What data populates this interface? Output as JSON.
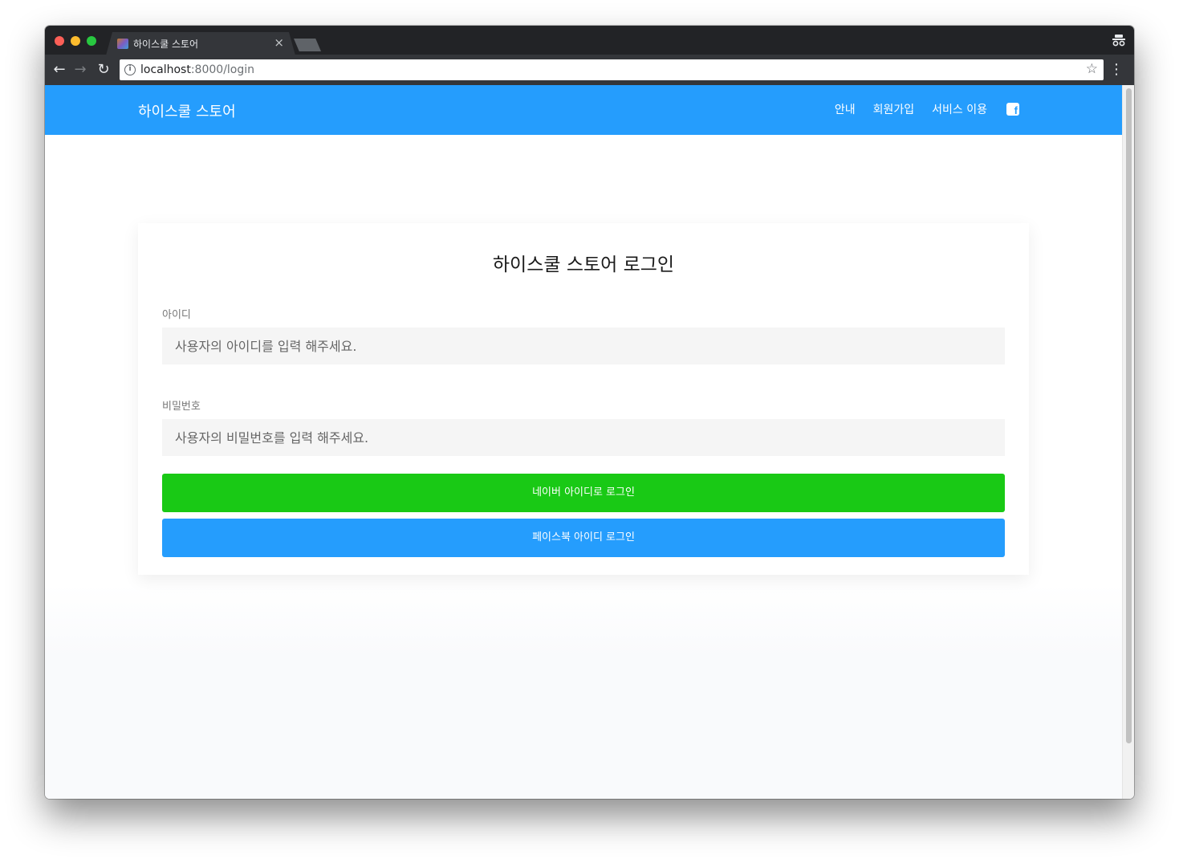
{
  "browser": {
    "tab_title": "하이스쿨 스토어",
    "tab_close": "×",
    "url_host": "localhost",
    "url_path": ":8000/login",
    "back_glyph": "←",
    "forward_glyph": "→",
    "reload_glyph": "↻",
    "star_glyph": "☆",
    "menu_glyph": "⋮",
    "info_glyph": "i"
  },
  "navbar": {
    "brand": "하이스쿨 스토어",
    "links": [
      "안내",
      "회원가입",
      "서비스 이용"
    ],
    "facebook_glyph": "f",
    "background_color": "#259dfd"
  },
  "login": {
    "title": "하이스쿨 스토어 로그인",
    "id_label": "아이디",
    "id_placeholder": "사용자의 아이디를 입력 해주세요.",
    "password_label": "비밀번호",
    "password_placeholder": "사용자의 비밀번호를 입력 해주세요.",
    "naver_button": "네이버 아이디로 로그인",
    "facebook_button": "페이스북 아이디 로그인",
    "naver_color": "#19c915",
    "facebook_color": "#259dfd"
  }
}
